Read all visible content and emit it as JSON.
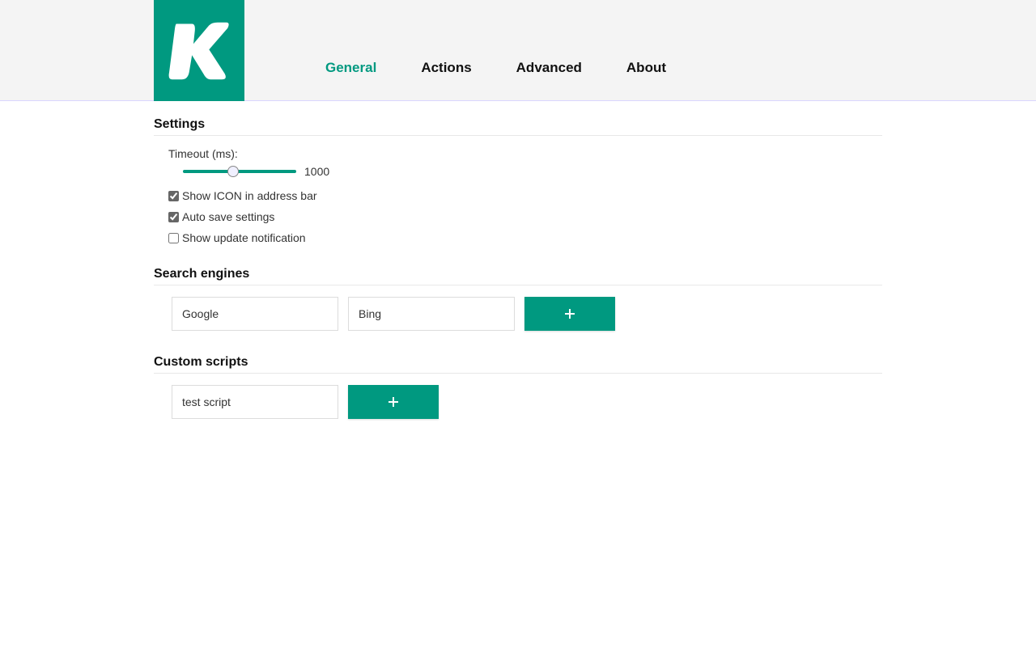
{
  "brand": {
    "accent": "#009980"
  },
  "nav": {
    "items": [
      {
        "label": "General",
        "active": true
      },
      {
        "label": "Actions",
        "active": false
      },
      {
        "label": "Advanced",
        "active": false
      },
      {
        "label": "About",
        "active": false
      }
    ]
  },
  "settings": {
    "title": "Settings",
    "timeout_label": "Timeout (ms):",
    "timeout_value": "1000",
    "checkboxes": [
      {
        "label": "Show ICON in address bar",
        "checked": true
      },
      {
        "label": "Auto save settings",
        "checked": true
      },
      {
        "label": "Show update notification",
        "checked": false
      }
    ]
  },
  "search_engines": {
    "title": "Search engines",
    "items": [
      {
        "label": "Google"
      },
      {
        "label": "Bing"
      }
    ],
    "add_icon": "plus"
  },
  "custom_scripts": {
    "title": "Custom scripts",
    "items": [
      {
        "label": "test script"
      }
    ],
    "add_icon": "plus"
  }
}
